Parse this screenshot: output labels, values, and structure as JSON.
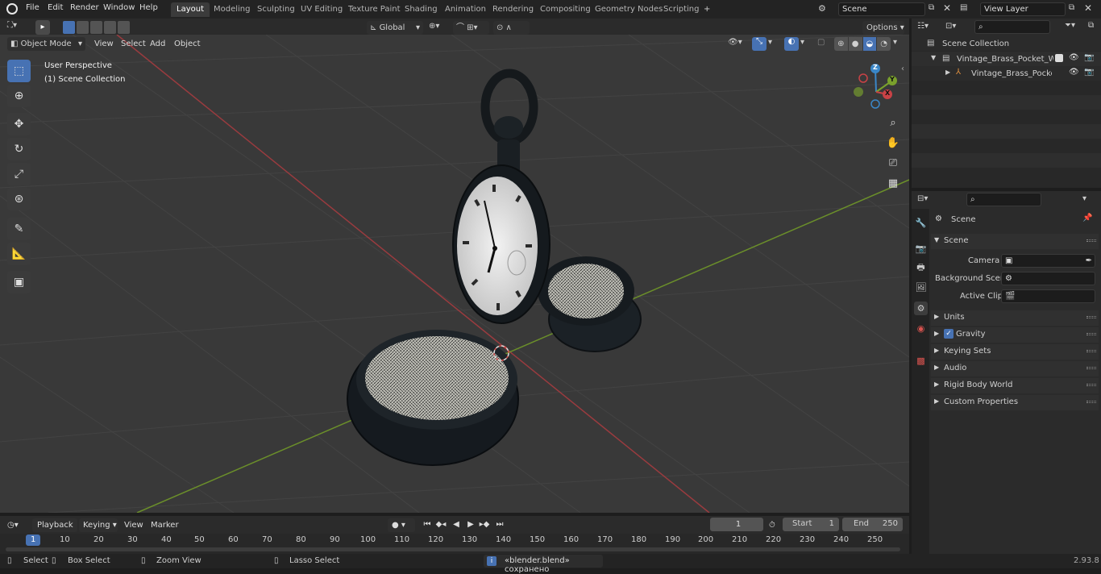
{
  "topbar": {
    "menus": [
      "File",
      "Edit",
      "Render",
      "Window",
      "Help"
    ],
    "workspace_tabs": [
      "Layout",
      "Modeling",
      "Sculpting",
      "UV Editing",
      "Texture Paint",
      "Shading",
      "Animation",
      "Rendering",
      "Compositing",
      "Geometry Nodes",
      "Scripting"
    ],
    "active_tab": "Layout",
    "add_tab_label": "+",
    "scene_name": "Scene",
    "view_layer": "View Layer"
  },
  "viewport_header": {
    "mode": "Object Mode",
    "menus": [
      "View",
      "Select",
      "Add",
      "Object"
    ],
    "transform_orientation": "Global",
    "options_label": "Options"
  },
  "viewport": {
    "perspective_label": "User Perspective",
    "collection_label": "(1) Scene Collection",
    "gizmo": {
      "z": "Z",
      "y": "Y",
      "x": "X"
    }
  },
  "outliner": {
    "root": "Scene Collection",
    "items": [
      {
        "label": "Vintage_Brass_Pocket_Watch"
      },
      {
        "label": "Vintage_Brass_Pocket_W"
      }
    ]
  },
  "properties": {
    "context_title": "Scene",
    "panel_title": "Scene",
    "fields": [
      {
        "label": "Camera"
      },
      {
        "label": "Background Scene"
      },
      {
        "label": "Active Clip"
      }
    ],
    "subpanels": [
      "Units",
      "Gravity",
      "Keying Sets",
      "Audio",
      "Rigid Body World",
      "Custom Properties"
    ]
  },
  "timeline": {
    "menus": [
      "Playback",
      "Keying",
      "View",
      "Marker"
    ],
    "current_frame": "1",
    "start_label": "Start",
    "start_value": "1",
    "end_label": "End",
    "end_value": "250",
    "ruler": [
      "1",
      "10",
      "20",
      "30",
      "40",
      "50",
      "60",
      "70",
      "80",
      "90",
      "100",
      "110",
      "120",
      "130",
      "140",
      "150",
      "160",
      "170",
      "180",
      "190",
      "200",
      "210",
      "220",
      "230",
      "240",
      "250"
    ]
  },
  "statusbar": {
    "select": "Select",
    "box_select": "Box Select",
    "zoom_view": "Zoom View",
    "lasso_select": "Lasso Select",
    "message": "«blender.blend» сохранено",
    "version": "2.93.8"
  },
  "colors": {
    "accent": "#4772b3",
    "x_axis": "#c94246",
    "y_axis": "#7aa12c",
    "z_axis": "#3a87c8"
  }
}
